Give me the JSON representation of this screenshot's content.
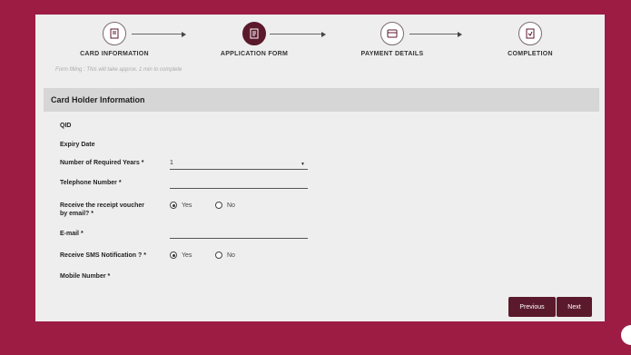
{
  "steps": [
    {
      "label": "CARD INFORMATION",
      "icon": "document-icon",
      "active": false
    },
    {
      "label": "APPLICATION FORM",
      "icon": "form-icon",
      "active": true
    },
    {
      "label": "PAYMENT DETAILS",
      "icon": "payment-icon",
      "active": false
    },
    {
      "label": "COMPLETION",
      "icon": "document-check-icon",
      "active": false
    }
  ],
  "hint": "Form filling : This will take approx. 1 min to complete",
  "section_title": "Card Holder Information",
  "fields": {
    "qid": "QID",
    "expiry": "Expiry Date",
    "years": "Number of Required Years",
    "years_value": "1",
    "telephone": "Telephone Number",
    "receipt_email_line1": "Receive the receipt voucher",
    "receipt_email_line2": "by email?",
    "email": "E-mail",
    "sms": "Receive SMS Notification ?",
    "mobile": "Mobile Number",
    "required_mark": "*"
  },
  "radios": {
    "yes": "Yes",
    "no": "No"
  },
  "buttons": {
    "previous": "Previous",
    "next": "Next"
  },
  "colors": {
    "brand": "#9c1c44",
    "button": "#5b1a2c",
    "panel": "#eeeeee"
  }
}
